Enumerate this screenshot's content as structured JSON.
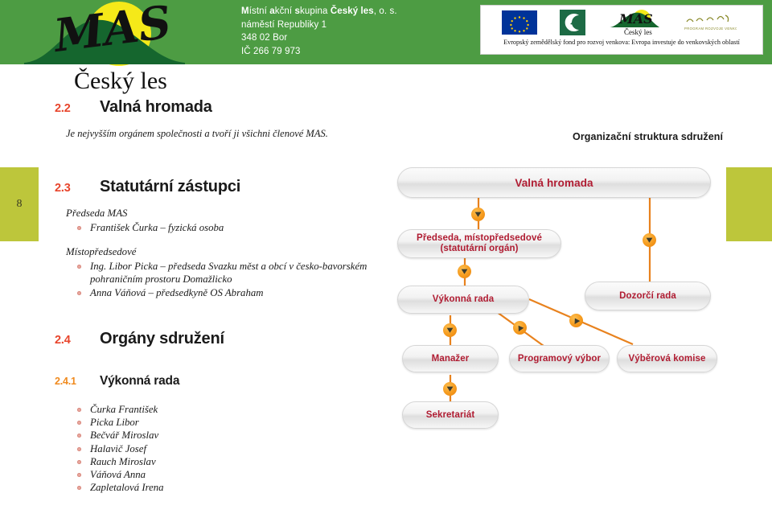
{
  "header": {
    "org_lines": [
      {
        "text_bold": "M",
        "rest": "ístní ",
        "b2": "akční ",
        "r2": "",
        "b3": "s",
        "r3": "kupina ",
        "b4": "Český les",
        "r4": ", o. s."
      },
      {
        "plain": "náměstí Republiky 1"
      },
      {
        "plain": "348 02 Bor"
      },
      {
        "plain": "IČ 266 79 973"
      }
    ],
    "address_line_1": "Místní akční skupina Český les, o. s.",
    "address_line_2": "náměstí Republiky 1",
    "address_line_3": "348 02 Bor",
    "address_line_4": "IČ 266 79 973",
    "logo_title": "MAS",
    "logo_subtitle": "Český les",
    "eu_caption": "Evropský zemědělský fond pro rozvoj venkova: Evropa investuje do venkovských oblastí",
    "eu_logo_names": [
      "eu-flag-logo",
      "leader-leaf-logo",
      "mas-cesky-les-logo",
      "program-rozvoje-venkova-logo"
    ]
  },
  "page": {
    "number": "8",
    "band_color": "#bdc63b",
    "header_color": "#4d9c43",
    "accent_red": "#e8452c",
    "accent_orange": "#f08a1e",
    "diagram_text_color": "#b01c32"
  },
  "sections": {
    "s22": {
      "number": "2.2",
      "title": "Valná hromada",
      "intro": "Je nejvyšším orgánem společnosti a tvoří ji všichni členové MAS."
    },
    "s23": {
      "number": "2.3",
      "title": "Statutární zástupci",
      "lead1": "Předseda MAS",
      "items1": [
        "František Čurka – fyzická osoba"
      ],
      "lead2": "Místopředsedové",
      "items2": [
        "Ing. Libor Picka – předseda Svazku měst a obcí v česko-bavorském pohraničním prostoru Domažlicko",
        "Anna Váňová – předsedkyně OS Abraham"
      ]
    },
    "s24": {
      "number": "2.4",
      "title": "Orgány sdružení"
    },
    "s241": {
      "number": "2.4.1",
      "title": "Výkonná rada",
      "items": [
        "Čurka František",
        "Picka Libor",
        "Bečvář Miroslav",
        "Halavič Josef",
        "Rauch Miroslav",
        "Váňová Anna",
        "Zapletalová Irena"
      ]
    }
  },
  "diagram": {
    "label": "Organizační struktura sdružení",
    "nodes": [
      {
        "id": "valna-hromada",
        "label": "Valná hromada"
      },
      {
        "id": "predseda",
        "label_line1": "Předseda, místopředsedové",
        "label_line2": "(statutární orgán)"
      },
      {
        "id": "vykonna-rada",
        "label": "Výkonná rada"
      },
      {
        "id": "dozorci-rada",
        "label": "Dozorčí rada"
      },
      {
        "id": "manazer",
        "label": "Manažer"
      },
      {
        "id": "programovy-vybor",
        "label": "Programový výbor"
      },
      {
        "id": "vyberova-komise",
        "label": "Výběrová komise"
      },
      {
        "id": "sekretariat",
        "label": "Sekretariát"
      }
    ]
  }
}
